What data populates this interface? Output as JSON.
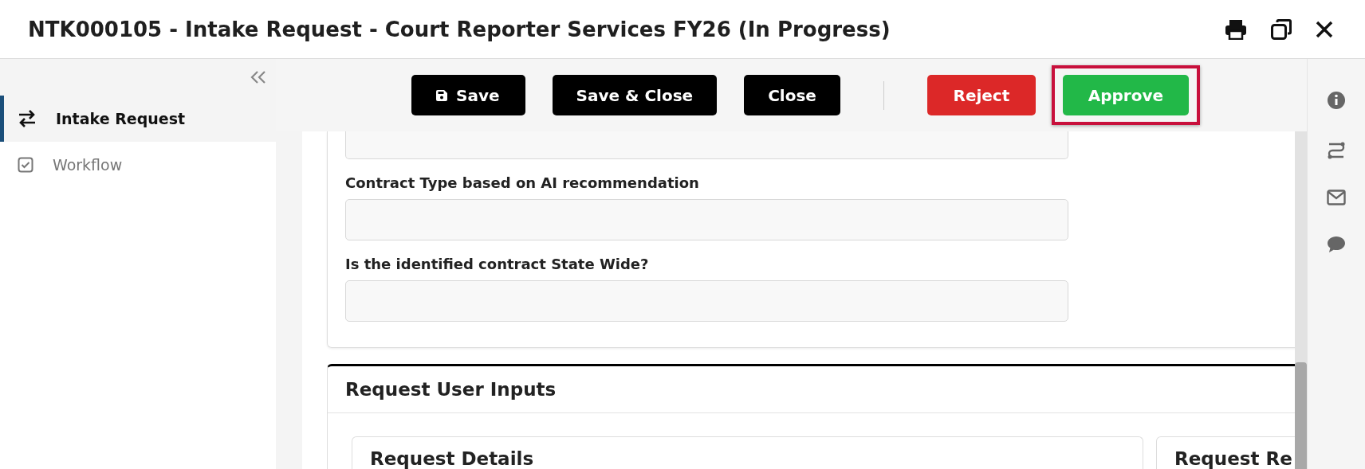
{
  "window": {
    "title": "NTK000105 - Intake Request - Court Reporter Services FY26 (In Progress)"
  },
  "sidebar": {
    "items": [
      {
        "label": "Intake Request",
        "selected": true
      },
      {
        "label": "Workflow",
        "selected": false
      }
    ]
  },
  "toolbar": {
    "buttons": [
      {
        "label": "Save",
        "kind": "save",
        "highlighted": false
      },
      {
        "label": "Save & Close",
        "kind": "dark",
        "highlighted": false
      },
      {
        "label": "Close",
        "kind": "dark",
        "highlighted": false
      },
      {
        "label": "Reject",
        "kind": "danger",
        "highlighted": false
      },
      {
        "label": "Approve",
        "kind": "success",
        "highlighted": true
      }
    ]
  },
  "form": {
    "fields": [
      {
        "cut": true
      },
      {
        "label": "Contract Type based on AI recommendation",
        "cut": false
      },
      {
        "label": "Is the identified contract State Wide?",
        "cut": false
      }
    ]
  },
  "section": {
    "title": "Request User Inputs",
    "cards": [
      "Request Details",
      "Request Re"
    ]
  }
}
